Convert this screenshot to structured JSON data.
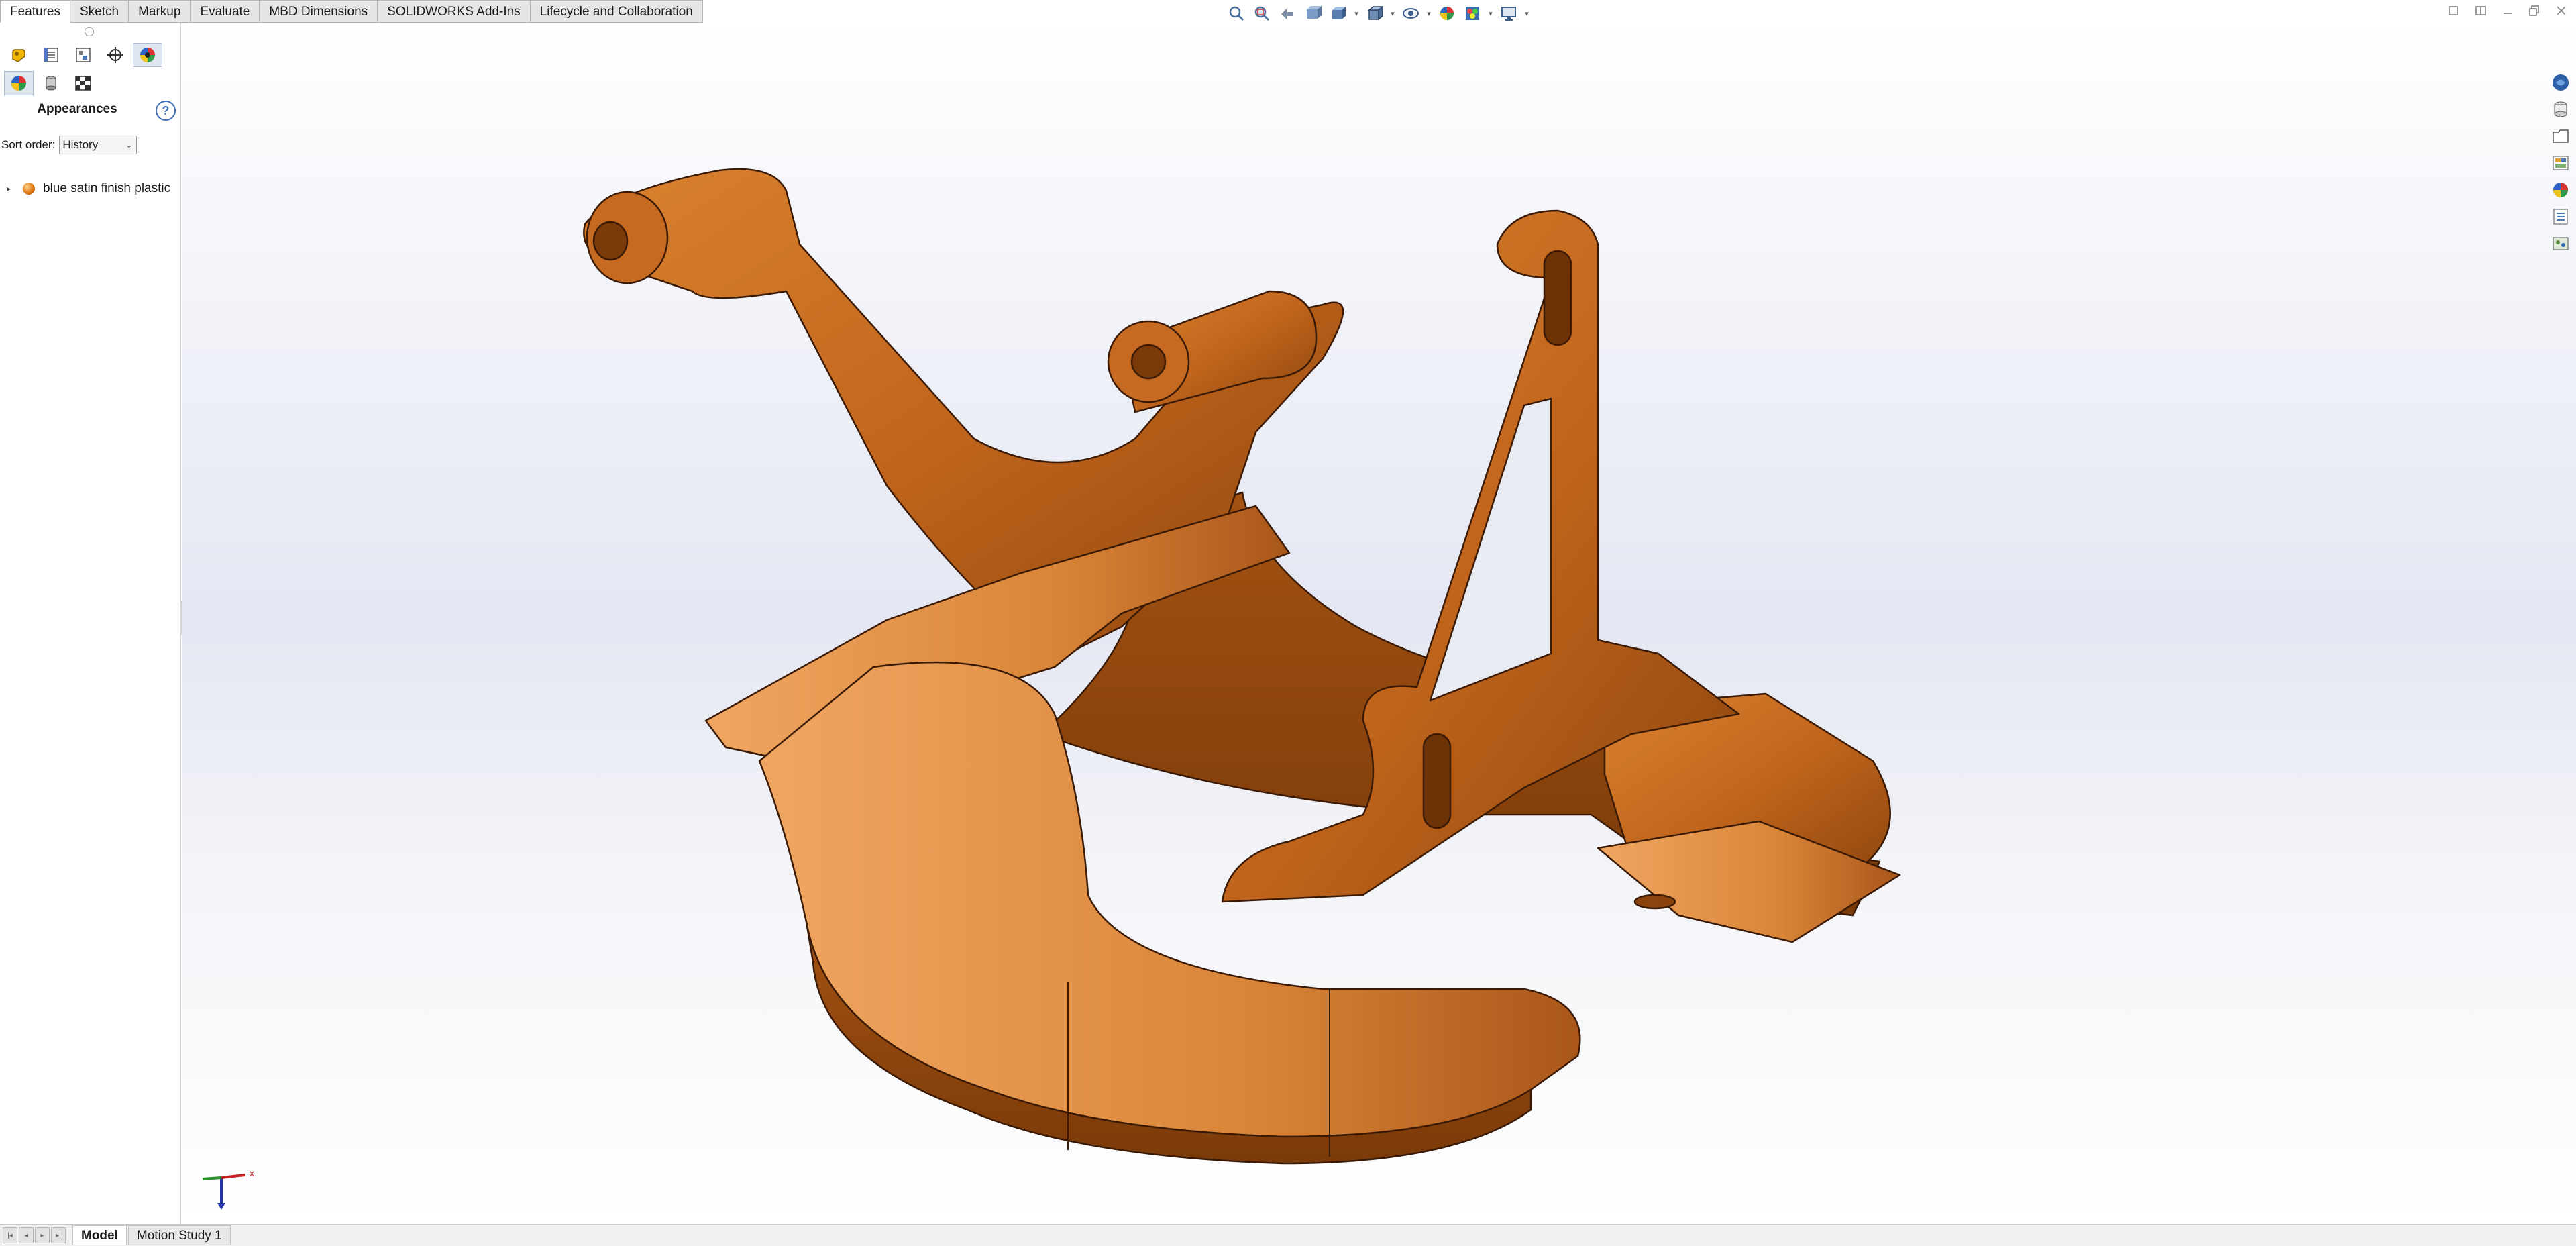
{
  "command_tabs": [
    {
      "label": "Features",
      "active": true
    },
    {
      "label": "Sketch",
      "active": false
    },
    {
      "label": "Markup",
      "active": false
    },
    {
      "label": "Evaluate",
      "active": false
    },
    {
      "label": "MBD Dimensions",
      "active": false
    },
    {
      "label": "SOLIDWORKS Add-Ins",
      "active": false
    },
    {
      "label": "Lifecycle and Collaboration",
      "active": false
    }
  ],
  "heads_up_toolbar": [
    "zoom-to-fit-icon",
    "zoom-to-area-icon",
    "previous-view-icon",
    "section-view-icon",
    "view-orientation-icon",
    "display-style-icon",
    "hide-show-items-icon",
    "edit-appearance-icon",
    "apply-scene-icon",
    "view-settings-icon"
  ],
  "window_controls": [
    "restore-icon",
    "tile-icon",
    "minimize-icon",
    "maximize-icon",
    "close-icon"
  ],
  "panel": {
    "title": "Appearances",
    "help_label": "?",
    "sort_label": "Sort order:",
    "sort_value": "History",
    "tree_items": [
      {
        "label": "blue satin finish plastic",
        "icon": "appearance-ball-icon",
        "color": "#e07a12"
      }
    ]
  },
  "task_pane": [
    "solidworks-resources-icon",
    "design-library-icon",
    "file-explorer-icon",
    "view-palette-icon",
    "appearances-scenes-icon",
    "custom-properties-icon",
    "forum-icon"
  ],
  "triad": {
    "x_label": "x"
  },
  "bottom_tabs": [
    {
      "label": "Model",
      "active": true
    },
    {
      "label": "Motion Study 1",
      "active": false
    }
  ],
  "colors": {
    "part_base": "#c9691f",
    "part_light": "#eda15a",
    "part_dark": "#8a430d",
    "accent_blue": "#3e6fb8"
  }
}
